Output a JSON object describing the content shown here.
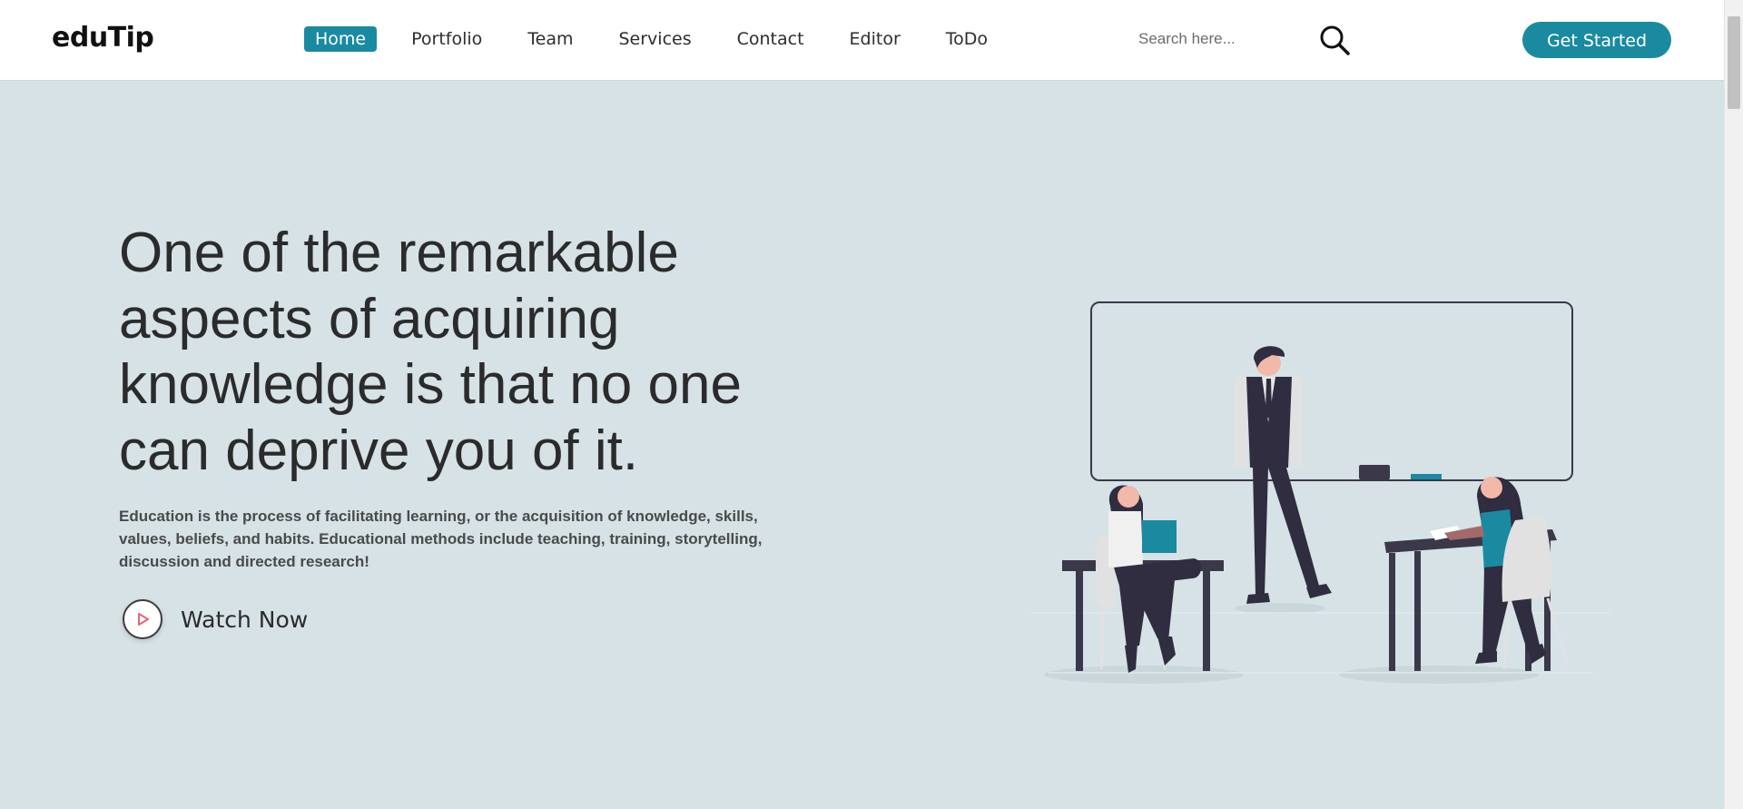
{
  "brand": {
    "logo": "eduTip"
  },
  "nav": {
    "items": [
      {
        "label": "Home",
        "active": true
      },
      {
        "label": "Portfolio",
        "active": false
      },
      {
        "label": "Team",
        "active": false
      },
      {
        "label": "Services",
        "active": false
      },
      {
        "label": "Contact",
        "active": false
      },
      {
        "label": "Editor",
        "active": false
      },
      {
        "label": "ToDo",
        "active": false
      }
    ]
  },
  "search": {
    "placeholder": "Search here...",
    "value": "",
    "icon": "search-icon"
  },
  "cta": {
    "label": "Get Started"
  },
  "hero": {
    "heading": "One of the remarkable aspects of acquiring knowledge is that no one can deprive you of it.",
    "text": "Education is the process of facilitating learning, or the acquisition of knowledge, skills, values, beliefs, and habits. Educational methods include teaching, training, storytelling, discussion and directed research!",
    "watch_label": "Watch Now",
    "play_icon": "play-icon"
  },
  "colors": {
    "accent": "#1a8aa0",
    "hero_background": "#d6e2e6",
    "header_background": "#ffffff",
    "text_dark": "#2b2b2b",
    "play_icon": "#e8637a"
  }
}
